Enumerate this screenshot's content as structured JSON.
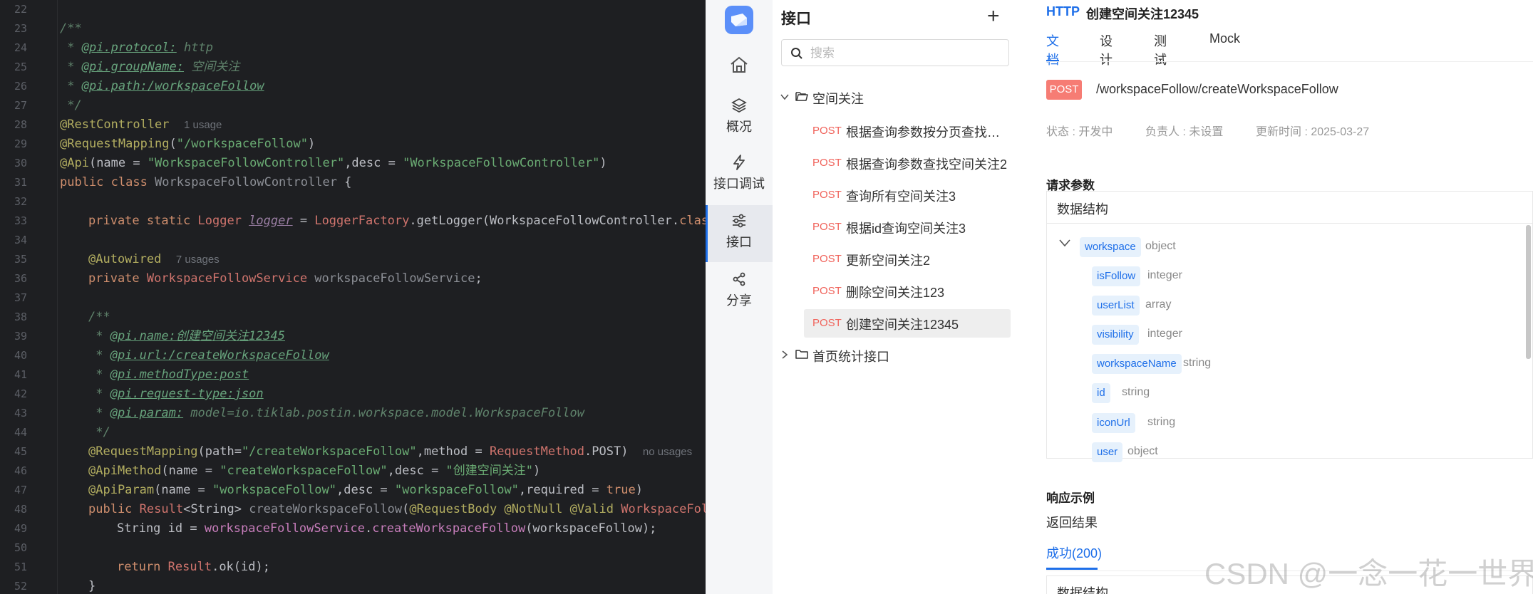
{
  "editor": {
    "line_numbers": [
      "22",
      "23",
      "24",
      "25",
      "26",
      "27",
      "28",
      "29",
      "30",
      "31",
      "32",
      "33",
      "34",
      "35",
      "36",
      "37",
      "38",
      "39",
      "40",
      "41",
      "42",
      "43",
      "44",
      "45",
      "46",
      "47",
      "48",
      "49",
      "50",
      "51",
      "52"
    ],
    "lines": {
      "l23": "/**",
      "l24_pre": " * ",
      "l24_tag": "@pi.protocol:",
      "l24_val": " http",
      "l25_pre": " * ",
      "l25_tag": "@pi.groupName:",
      "l25_val": " 空间关注",
      "l26_pre": " * ",
      "l26_tag": "@pi.path:/workspaceFollow",
      "l27": " */",
      "l28_ann": "@RestController",
      "l28_hint": "1 usage",
      "l29_ann": "@RequestMapping",
      "l29_p1": "(",
      "l29_str": "\"/workspaceFollow\"",
      "l29_p2": ")",
      "l30_ann": "@Api",
      "l30_p1": "(name = ",
      "l30_s1": "\"WorkspaceFollowController\"",
      "l30_p2": ",desc = ",
      "l30_s2": "\"WorkspaceFollowController\"",
      "l30_p3": ")",
      "l31_kw": "public class ",
      "l31_cls": "WorkspaceFollowController",
      "l31_p": " {",
      "l33_kw": "private static ",
      "l33_t": "Logger ",
      "l33_f": "logger",
      "l33_p1": " = ",
      "l33_c": "LoggerFactory",
      "l33_p2": ".getLogger(WorkspaceFollowController.",
      "l33_kw2": "class",
      "l35_ann": "@Autowired",
      "l35_hint": "7 usages",
      "l36_kw": "private ",
      "l36_t": "WorkspaceFollowService ",
      "l36_f": "workspaceFollowService",
      "l36_p": ";",
      "l38": "/**",
      "l39_pre": " * ",
      "l39_tag": "@pi.name:创建空间关注12345",
      "l40_pre": " * ",
      "l40_tag": "@pi.url:/createWorkspaceFollow",
      "l41_pre": " * ",
      "l41_tag": "@pi.methodType:post",
      "l42_pre": " * ",
      "l42_tag": "@pi.request-type:json",
      "l43_pre": " * ",
      "l43_tag": "@pi.param:",
      "l43_val": " model=io.tiklab.postin.workspace.model.WorkspaceFollow",
      "l44": " */",
      "l45_ann": "@RequestMapping",
      "l45_p1": "(path=",
      "l45_s": "\"/createWorkspaceFollow\"",
      "l45_p2": ",method = ",
      "l45_c": "RequestMethod",
      "l45_p3": ".POST)",
      "l45_hint": "no usages",
      "l46_ann": "@ApiMethod",
      "l46_p1": "(name = ",
      "l46_s1": "\"createWorkspaceFollow\"",
      "l46_p2": ",desc = ",
      "l46_s2": "\"创建空间关注\"",
      "l46_p3": ")",
      "l47_ann": "@ApiParam",
      "l47_p1": "(name = ",
      "l47_s1": "\"workspaceFollow\"",
      "l47_p2": ",desc = ",
      "l47_s2": "\"workspaceFollow\"",
      "l47_p3": ",required = ",
      "l47_kw": "true",
      "l47_p4": ")",
      "l48_kw": "public ",
      "l48_t": "Result",
      "l48_p1": "<String> ",
      "l48_m": "createWorkspaceFollow",
      "l48_p2": "(",
      "l48_a1": "@RequestBody ",
      "l48_a2": "@NotNull ",
      "l48_a3": "@Valid ",
      "l48_t2": "WorkspaceFollo",
      "l49_p1": "String id = ",
      "l49_f": "workspaceFollowService",
      "l49_p2": ".",
      "l49_m": "createWorkspaceFollow",
      "l49_p3": "(workspaceFollow);",
      "l51_kw": "return ",
      "l51_t": "Result",
      "l51_p": ".ok(id);",
      "l52": "}"
    }
  },
  "rail": {
    "items": [
      {
        "label": "概况",
        "icon": "layers-icon"
      },
      {
        "label": "接口调试",
        "icon": "lightning-icon"
      },
      {
        "label": "接口",
        "icon": "sliders-icon"
      },
      {
        "label": "分享",
        "icon": "share-icon"
      }
    ]
  },
  "tree": {
    "title": "接口",
    "add": "+",
    "search_placeholder": "搜索",
    "folders": [
      {
        "name": "空间关注",
        "expanded": true
      },
      {
        "name": "首页统计接口",
        "expanded": false
      }
    ],
    "apis": [
      {
        "method": "POST",
        "name": "根据查询参数按分页查找空间关注"
      },
      {
        "method": "POST",
        "name": "根据查询参数查找空间关注2"
      },
      {
        "method": "POST",
        "name": "查询所有空间关注3"
      },
      {
        "method": "POST",
        "name": "根据id查询空间关注3"
      },
      {
        "method": "POST",
        "name": "更新空间关注2"
      },
      {
        "method": "POST",
        "name": "删除空间关注123"
      },
      {
        "method": "POST",
        "name": "创建空间关注12345"
      }
    ]
  },
  "detail": {
    "protocol": "HTTP",
    "title": "创建空间关注12345",
    "tabs": [
      "文档",
      "设计",
      "测试",
      "Mock"
    ],
    "method_badge": "POST",
    "path": "/workspaceFollow/createWorkspaceFollow",
    "status": "状态 : 开发中",
    "owner": "负责人 : 未设置",
    "updated": "更新时间 : 2025-03-27",
    "request_title": "请求参数",
    "struct_label": "数据结构",
    "params": [
      {
        "name": "workspace",
        "type": "object"
      },
      {
        "name": "isFollow",
        "type": "integer"
      },
      {
        "name": "userList",
        "type": "array"
      },
      {
        "name": "visibility",
        "type": "integer"
      },
      {
        "name": "workspaceName",
        "type": "string"
      },
      {
        "name": "id",
        "type": "string"
      },
      {
        "name": "iconUrl",
        "type": "string"
      },
      {
        "name": "user",
        "type": "object"
      }
    ],
    "response_title": "响应示例",
    "return_label": "返回结果",
    "success_tab": "成功(200)",
    "struct_label2": "数据结构"
  },
  "watermark": "CSDN @一念一花一世界",
  "colors": {
    "accent": "#1e6fe9",
    "post": "#f67c74",
    "editor_bg": "#1e1f22"
  }
}
